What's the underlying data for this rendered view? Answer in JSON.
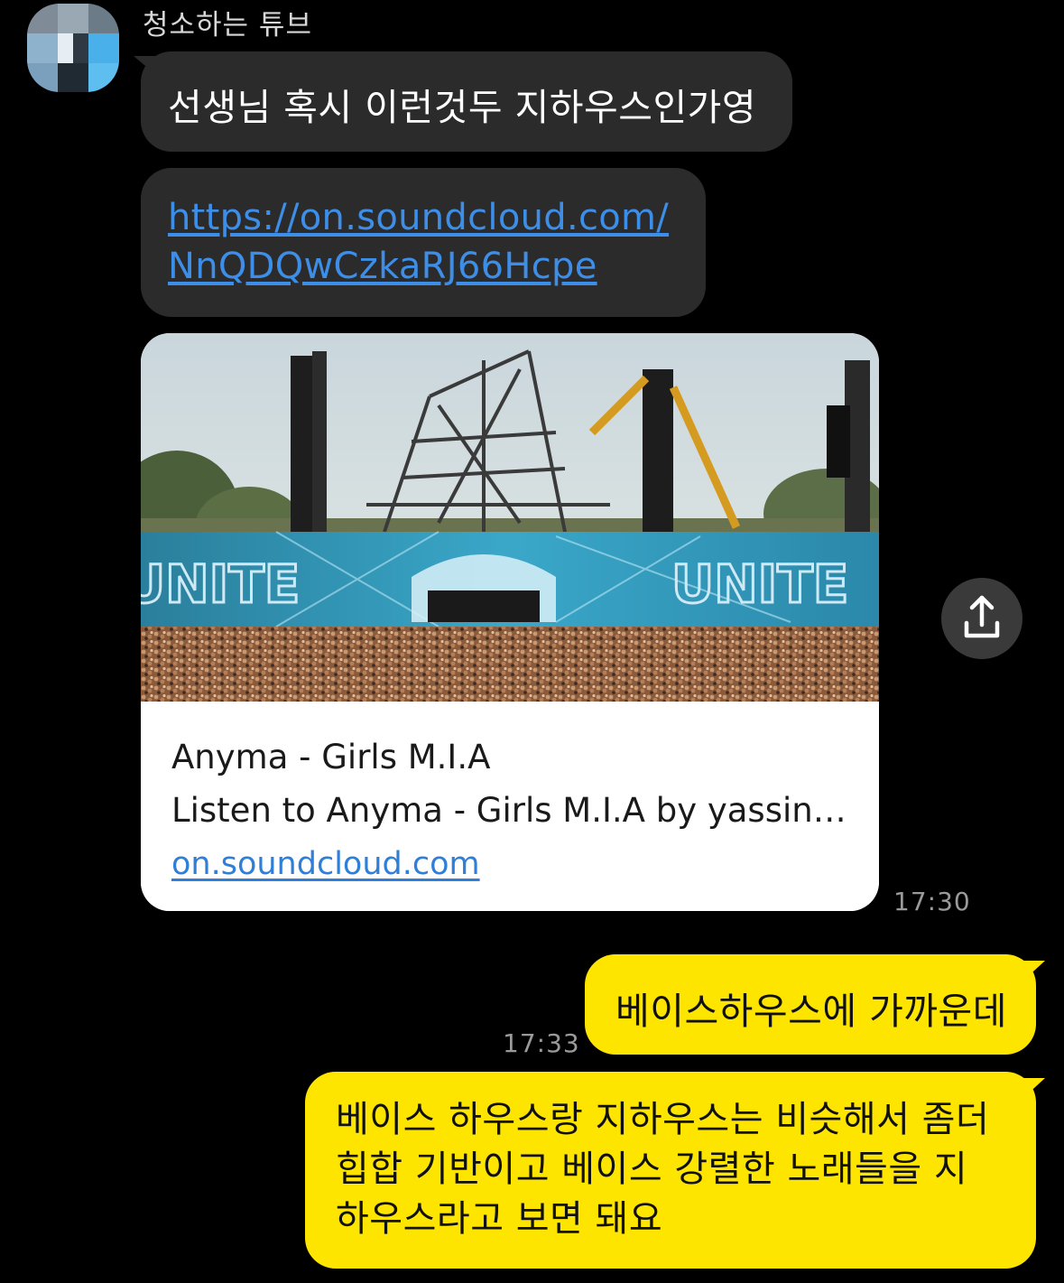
{
  "chat": {
    "sender_name": "청소하는 튜브",
    "incoming": {
      "text": "선생님 혹시 이런것두 지하우스인가영",
      "link": "https://on.soundcloud.com/NnQDQwCzkaRJ66Hcpe",
      "preview": {
        "title": "Anyma - Girls M.I.A",
        "description": "Listen to Anyma - Girls M.I.A by yassins...",
        "domain": "on.soundcloud.com",
        "banner_text_left": "UNITE",
        "banner_text_right": "UNITE"
      },
      "time": "17:30"
    },
    "outgoing": [
      {
        "text": "베이스하우스에 가까운데",
        "time": "17:33"
      },
      {
        "text": "베이스 하우스랑 지하우스는 비슷해서 좀더\n힙합 기반이고 베이스 강렬한 노래들을 지\n하우스라고 보면 돼요"
      }
    ]
  },
  "icons": {
    "share": "share-icon"
  },
  "colors": {
    "background": "#000000",
    "incoming_bubble": "#2b2b2b",
    "outgoing_bubble": "#fee500",
    "link": "#3d8ee8"
  }
}
